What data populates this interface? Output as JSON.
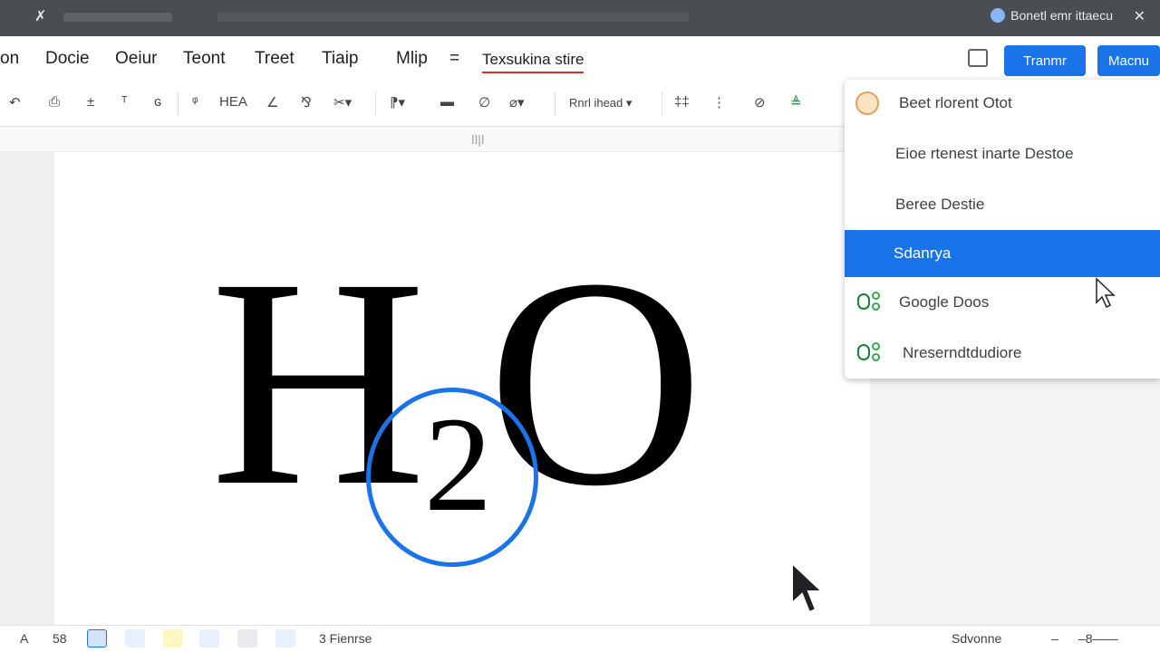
{
  "topbar": {
    "sys_glyph": "✗",
    "account_label": "Bonetl emr ittaecu",
    "close_glyph": "✕"
  },
  "menu": {
    "items": [
      "on",
      "Docie",
      "Oeiur",
      "Teont",
      "Treet",
      "Tiaip",
      "Mlip",
      "="
    ],
    "active_tab": "Texsukina stire"
  },
  "actions": {
    "primary_button": "Tranmr",
    "secondary_button": "Macnu"
  },
  "toolbar": {
    "items": [
      "↶",
      "⎙",
      "±",
      "ᵀ",
      "ɢ",
      "ᵠ",
      "HEA",
      "∠",
      "⅋",
      "✂▾",
      "⁋▾",
      "▬",
      "∅",
      "⌀▾",
      "Rnrl ihead ▾",
      "‡‡",
      "⋮",
      "⊘",
      "≜"
    ]
  },
  "ruler": {
    "marker": "ǀǀ|ǀ"
  },
  "document": {
    "formula_h": "H",
    "formula_sub": "2",
    "formula_o": "O"
  },
  "dropdown": {
    "items": [
      {
        "label": "Beet rlorent Otot",
        "icon": "avatar-icon"
      },
      {
        "label": "Eioe rtenest inarte Destoe",
        "icon": "none"
      },
      {
        "label": "Beree Destie",
        "icon": "none"
      },
      {
        "label": "Sdanrya",
        "icon": "none",
        "selected": true
      },
      {
        "label": "Google Doos",
        "icon": "google-docs-icon"
      },
      {
        "label": "Nreserndtdudiore",
        "icon": "google-docs-icon"
      }
    ]
  },
  "statusbar": {
    "left_items": [
      "A",
      "58"
    ],
    "page_count": "3 Fienrse",
    "zoom_label": "Sdvonne",
    "zoom_minus": "–",
    "zoom_slider": "–8——"
  },
  "colors": {
    "accent": "#1a73e8",
    "topbar": "#4a4d51",
    "active_underline": "#d93025"
  }
}
